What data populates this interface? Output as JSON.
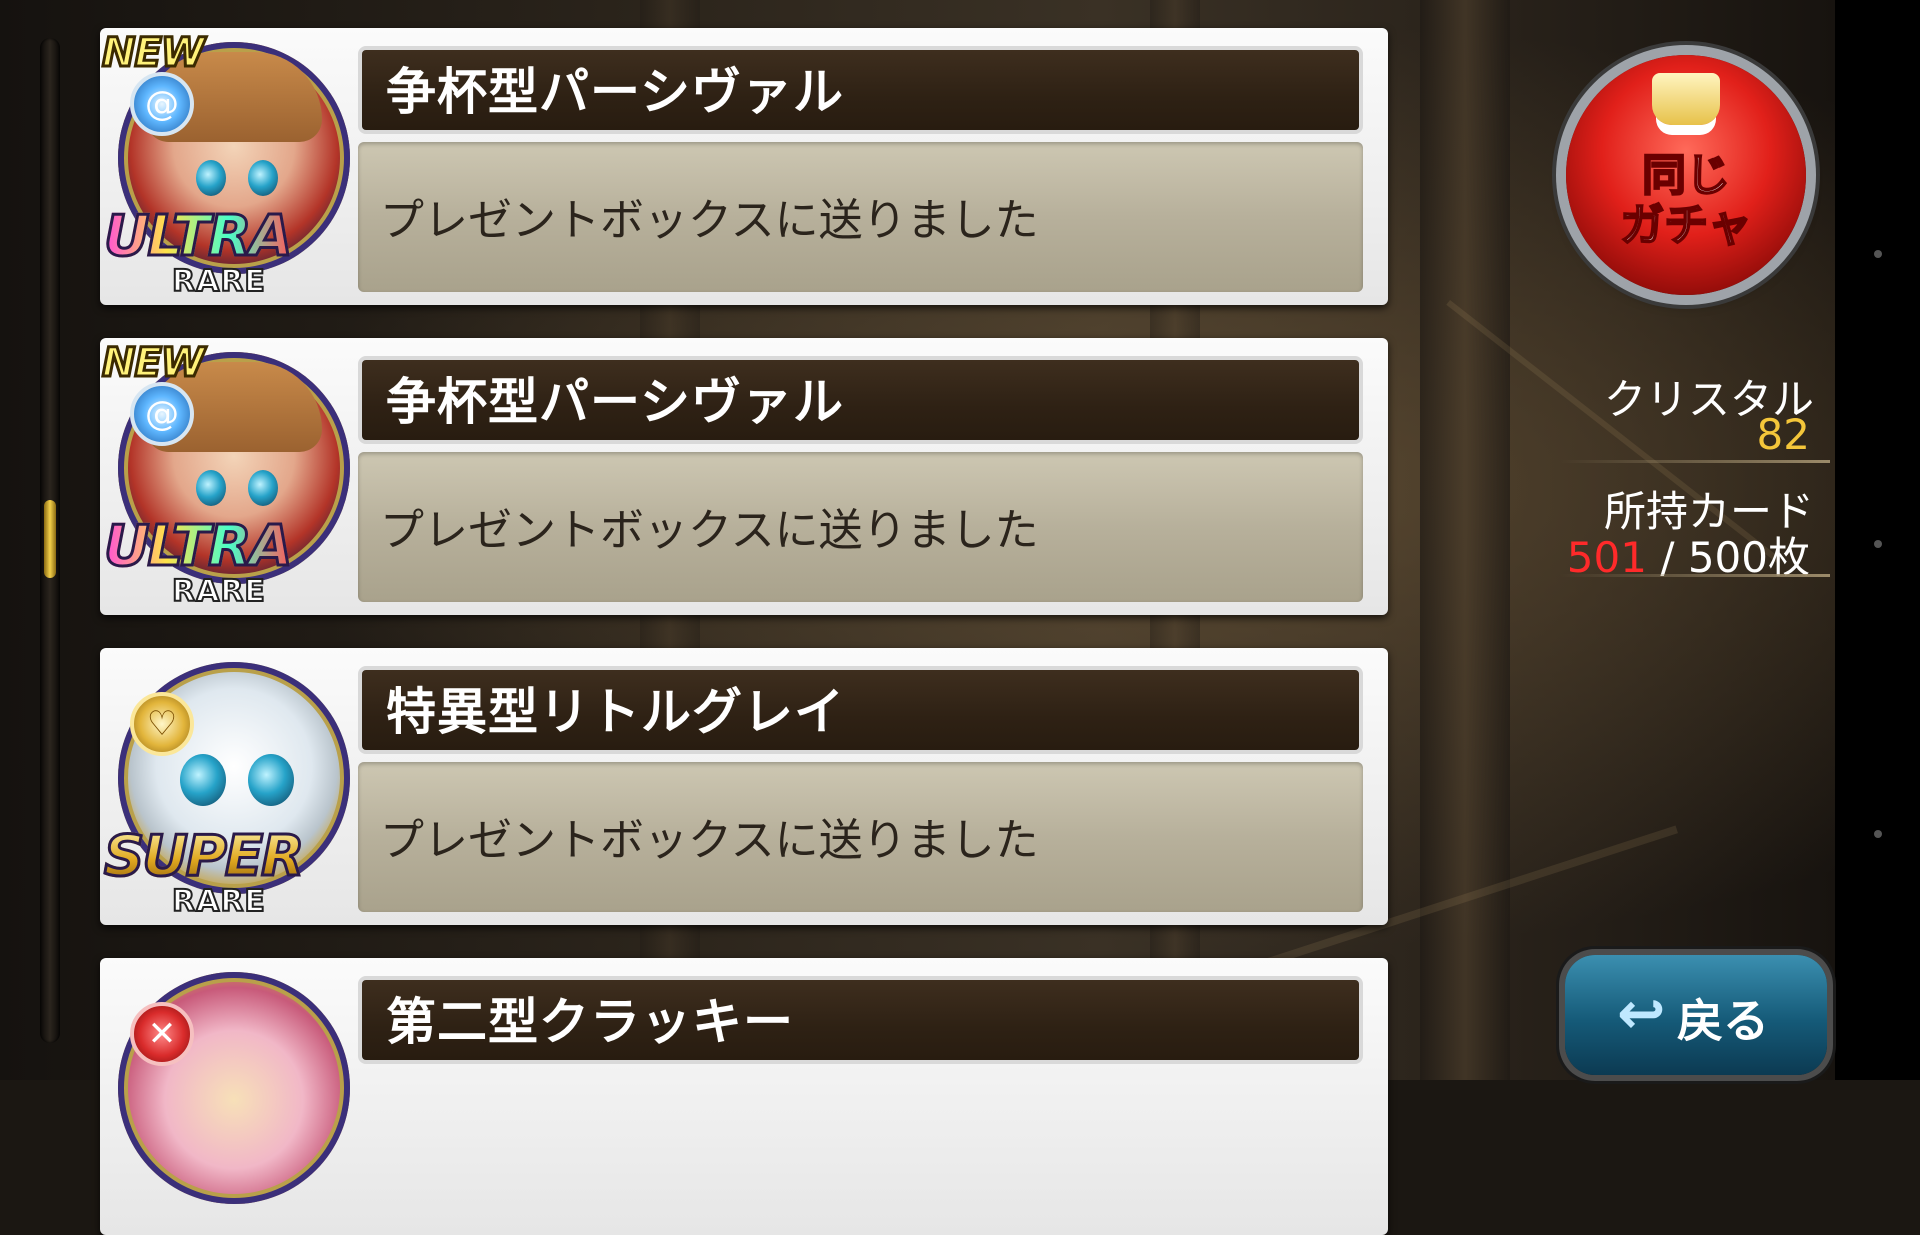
{
  "results": [
    {
      "name": "争杯型パーシヴァル",
      "message": "プレゼントボックスに送りました",
      "new_badge": "NEW",
      "rarity_top": "ULTRA",
      "rarity_bottom": "RARE",
      "element_icon": "water-swirl-icon"
    },
    {
      "name": "争杯型パーシヴァル",
      "message": "プレゼントボックスに送りました",
      "new_badge": "NEW",
      "rarity_top": "ULTRA",
      "rarity_bottom": "RARE",
      "element_icon": "water-swirl-icon"
    },
    {
      "name": "特異型リトルグレイ",
      "message": "プレゼントボックスに送りました",
      "rarity_top": "SUPER",
      "rarity_bottom": "RARE",
      "element_icon": "heart-crown-icon"
    },
    {
      "name": "第二型クラッキー",
      "element_icon": "crossed-swords-icon"
    }
  ],
  "gacha_button": {
    "label": "同じ\nガチャ"
  },
  "crystal": {
    "label": "クリスタル",
    "value": "82"
  },
  "cards": {
    "label": "所持カード",
    "current": "501",
    "separator": " / ",
    "max": "500枚"
  },
  "back_button": {
    "label": "戻る"
  },
  "colors": {
    "accent_gold": "#f4c63a",
    "over_limit_red": "#ff2a2a",
    "name_bar": "#2e2114"
  }
}
